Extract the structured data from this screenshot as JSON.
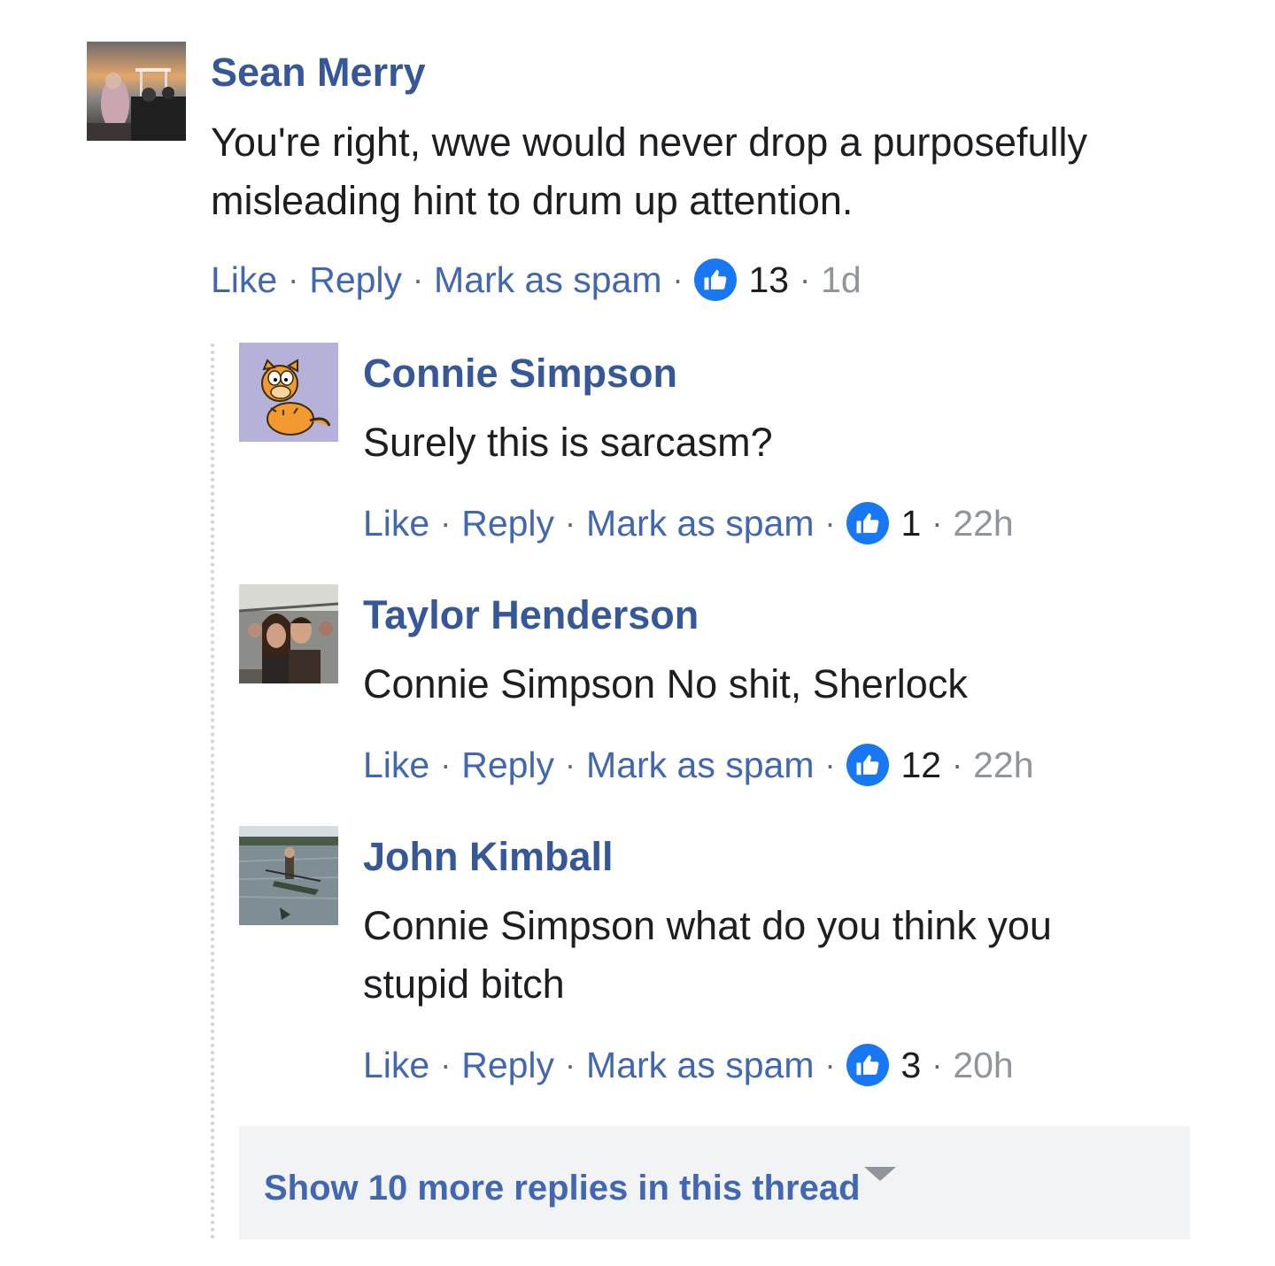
{
  "comments": [
    {
      "name": "Sean Merry",
      "text": "You're right, wwe would never drop a purposefully misleading hint to drum up attention.",
      "like_label": "Like",
      "reply_label": "Reply",
      "spam_label": "Mark as spam",
      "separator": "·",
      "likes": "13",
      "time": "1d",
      "avatar": "sunset-boat-photo"
    },
    {
      "name": "Connie Simpson",
      "text": "Surely this is sarcasm?",
      "like_label": "Like",
      "reply_label": "Reply",
      "spam_label": "Mark as spam",
      "separator": "·",
      "likes": "1",
      "time": "22h",
      "avatar": "garfield-cartoon"
    },
    {
      "name": "Taylor Henderson",
      "text": "Connie Simpson No shit, Sherlock",
      "like_label": "Like",
      "reply_label": "Reply",
      "spam_label": "Mark as spam",
      "separator": "·",
      "likes": "12",
      "time": "22h",
      "avatar": "two-men-selfie-photo"
    },
    {
      "name": "John Kimball",
      "text": "Connie Simpson what do you think you stupid bitch",
      "like_label": "Like",
      "reply_label": "Reply",
      "spam_label": "Mark as spam",
      "separator": "·",
      "likes": "3",
      "time": "20h",
      "avatar": "kayak-lake-photo"
    }
  ],
  "more_replies": {
    "label": "Show 10 more replies in this thread",
    "icon": "caret-down-icon"
  },
  "colors": {
    "name": "#365899",
    "link": "#4267b2",
    "like_badge": "#1877f2",
    "meta": "#90949c",
    "more_bg": "#f2f3f5"
  }
}
